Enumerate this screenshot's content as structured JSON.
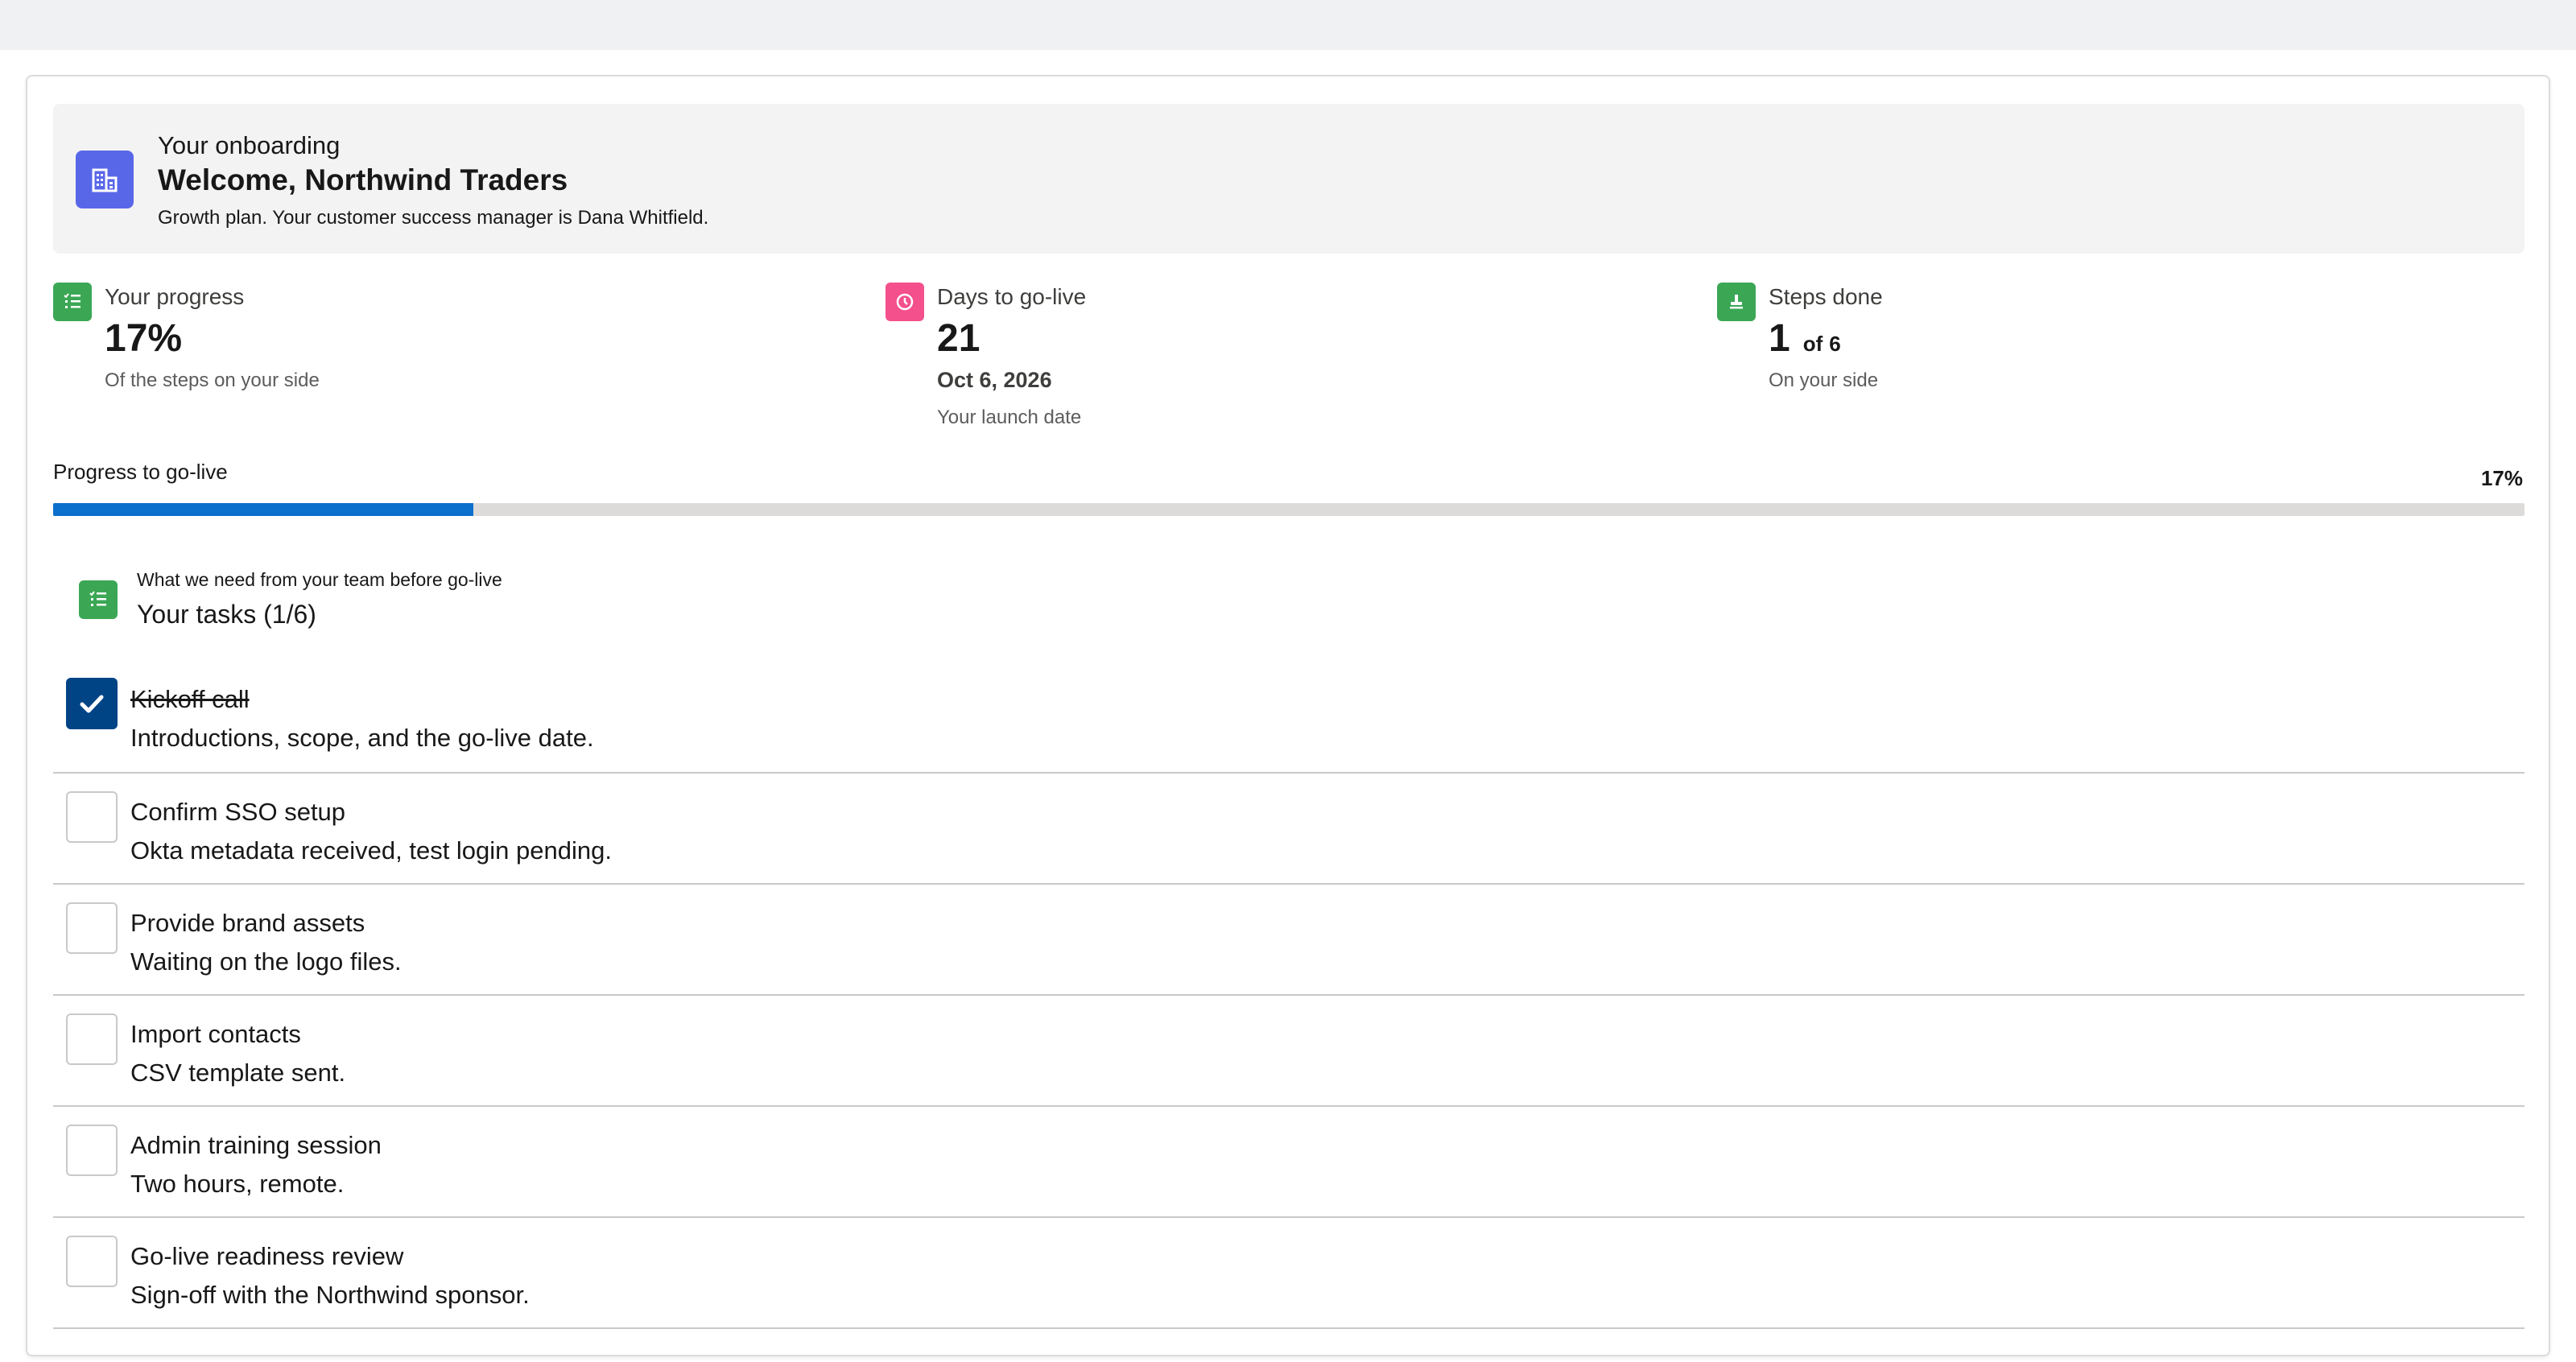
{
  "banner": {
    "eyebrow": "Your onboarding",
    "title": "Welcome, Northwind Traders",
    "subtitle": "Growth plan. Your customer success manager is Dana Whitfield.",
    "icon": "building-icon",
    "icon_color": "#5867e8"
  },
  "stats": {
    "progress": {
      "label": "Your progress",
      "value": "17%",
      "detail": "Of the steps on your side",
      "icon": "task-list-icon",
      "icon_color": "#3ba755"
    },
    "days": {
      "label": "Days to go-live",
      "value": "21",
      "date": "Oct 6, 2026",
      "detail": "Your launch date",
      "icon": "clock-icon",
      "icon_color": "#f4508c"
    },
    "steps": {
      "label": "Steps done",
      "value": "1",
      "of": "of",
      "total": "6",
      "detail": "On your side",
      "icon": "stamp-icon",
      "icon_color": "#3ba755"
    }
  },
  "progress_bar": {
    "label": "Progress to go-live",
    "percent_text": "17%",
    "fraction": 0.17,
    "fill_color": "#0b6fcc"
  },
  "tasks": {
    "eyebrow": "What we need from your team before go-live",
    "title": "Your tasks (1/6)",
    "icon": "task-list-icon",
    "items": [
      {
        "title": "Kickoff call",
        "desc": "Introductions, scope, and the go-live date.",
        "done": true
      },
      {
        "title": "Confirm SSO setup",
        "desc": "Okta metadata received, test login pending.",
        "done": false
      },
      {
        "title": "Provide brand assets",
        "desc": "Waiting on the logo files.",
        "done": false
      },
      {
        "title": "Import contacts",
        "desc": "CSV template sent.",
        "done": false
      },
      {
        "title": "Admin training session",
        "desc": "Two hours, remote.",
        "done": false
      },
      {
        "title": "Go-live readiness review",
        "desc": "Sign-off with the Northwind sponsor.",
        "done": false
      }
    ]
  }
}
